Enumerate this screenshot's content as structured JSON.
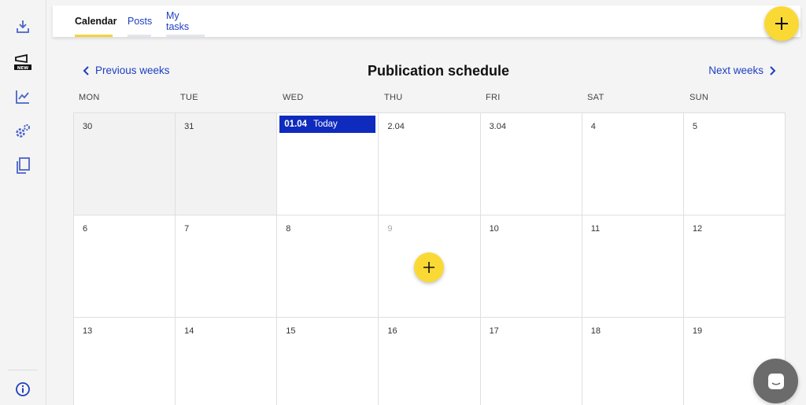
{
  "sidebar": {
    "items": [
      {
        "icon": "download-icon"
      },
      {
        "icon": "megaphone-new-icon",
        "badge": "NEW"
      },
      {
        "icon": "analytics-chart-icon"
      },
      {
        "icon": "settings-gears-icon"
      },
      {
        "icon": "documents-copy-icon"
      }
    ],
    "footer_icon": "info-icon"
  },
  "tabs": [
    {
      "label": "Calendar",
      "active": true
    },
    {
      "label": "Posts",
      "active": false
    },
    {
      "label": "My tasks",
      "active": false
    }
  ],
  "header": {
    "title": "Publication schedule",
    "prev_label": "Previous weeks",
    "next_label": "Next weeks"
  },
  "weekdays": [
    "MON",
    "TUE",
    "WED",
    "THU",
    "FRI",
    "SAT",
    "SUN"
  ],
  "calendar": {
    "weeks": [
      [
        "30",
        "31",
        "01.04",
        "2.04",
        "3.04",
        "4",
        "5"
      ],
      [
        "6",
        "7",
        "8",
        "9",
        "10",
        "11",
        "12"
      ],
      [
        "13",
        "14",
        "15",
        "16",
        "17",
        "18",
        "19"
      ]
    ],
    "today_date": "01.04",
    "today_label": "Today"
  },
  "colors": {
    "accent_yellow": "#fbd934",
    "link_blue": "#1f3fbf",
    "today_blue": "#0f2bbd"
  }
}
